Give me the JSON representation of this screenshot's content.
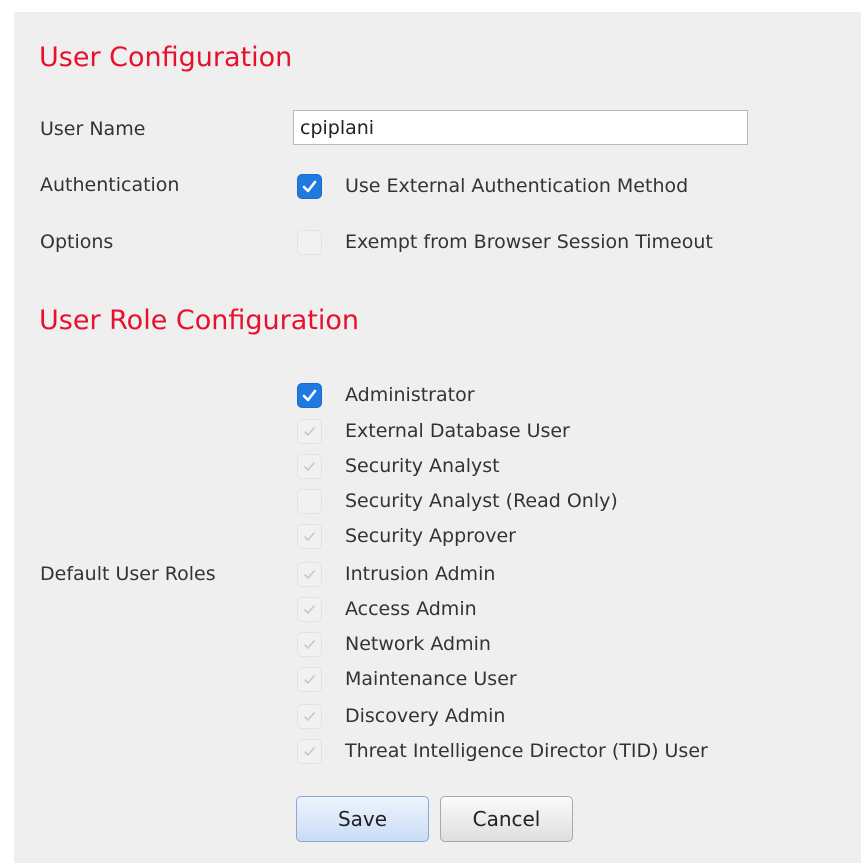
{
  "user_config": {
    "title": "User Configuration",
    "username_label": "User Name",
    "username_value": "cpiplani",
    "authentication_label": "Authentication",
    "authentication_option": {
      "label": "Use External Authentication Method",
      "checked": true,
      "enabled": true
    },
    "options_label": "Options",
    "options_option": {
      "label": "Exempt from Browser Session Timeout",
      "checked": false,
      "enabled": false
    }
  },
  "role_config": {
    "title": "User Role Configuration",
    "roles_label": "Default User Roles",
    "roles": [
      {
        "label": "Administrator",
        "checked": true,
        "enabled": true
      },
      {
        "label": "External Database User",
        "checked": true,
        "enabled": false
      },
      {
        "label": "Security Analyst",
        "checked": true,
        "enabled": false
      },
      {
        "label": "Security Analyst (Read Only)",
        "checked": false,
        "enabled": false
      },
      {
        "label": "Security Approver",
        "checked": true,
        "enabled": false
      },
      {
        "label": "Intrusion Admin",
        "checked": true,
        "enabled": false
      },
      {
        "label": "Access Admin",
        "checked": true,
        "enabled": false
      },
      {
        "label": "Network Admin",
        "checked": true,
        "enabled": false
      },
      {
        "label": "Maintenance User",
        "checked": true,
        "enabled": false
      },
      {
        "label": "Discovery Admin",
        "checked": true,
        "enabled": false
      },
      {
        "label": "Threat Intelligence Director (TID) User",
        "checked": true,
        "enabled": false
      }
    ]
  },
  "buttons": {
    "save_label": "Save",
    "cancel_label": "Cancel"
  },
  "colors": {
    "heading": "#e8112d",
    "checkbox_checked": "#1f7ae0",
    "checkmark_disabled": "#c8c8c8",
    "panel_bg": "#efefef"
  }
}
